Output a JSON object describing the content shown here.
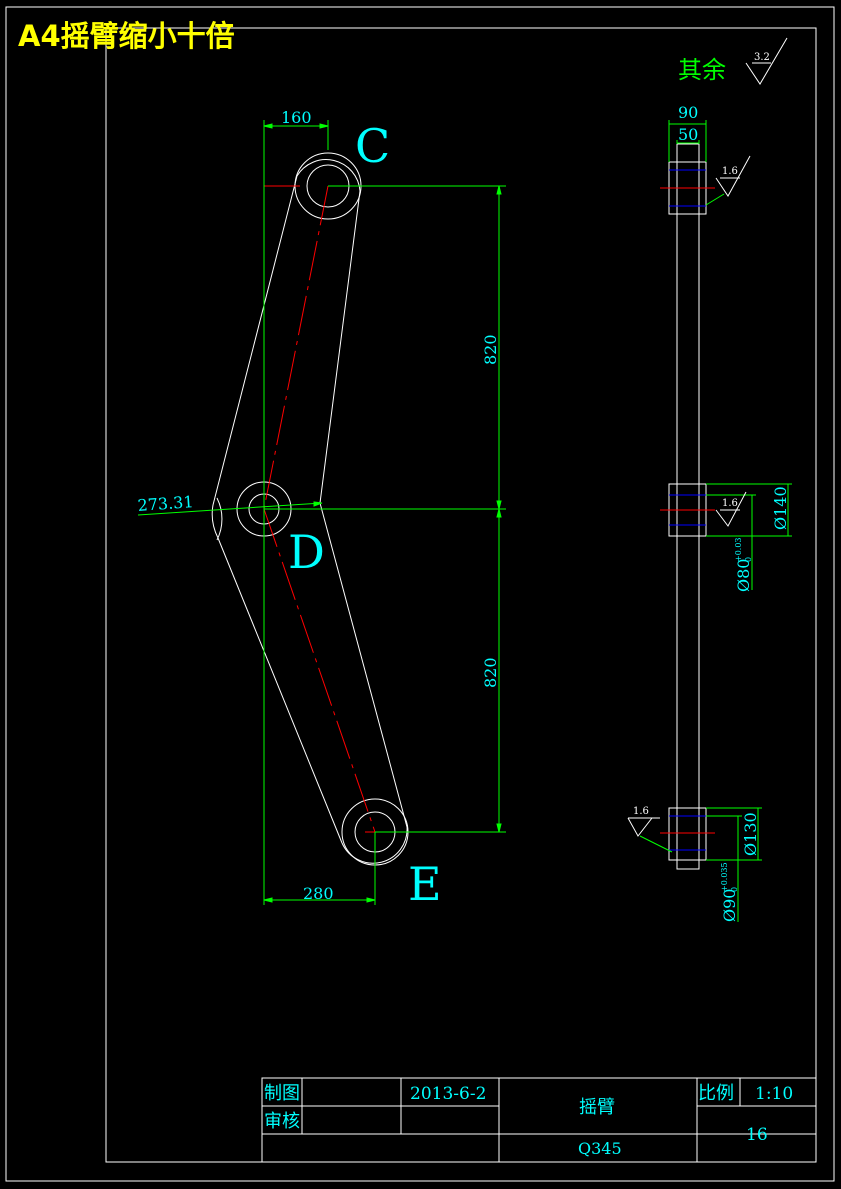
{
  "sheet_title": "A4摇臂缩小十倍",
  "surface_note": {
    "prefix": "其余",
    "roughness": "3.2"
  },
  "points": {
    "c": "C",
    "d": "D",
    "e": "E"
  },
  "dims": {
    "top_width": "160",
    "bottom_width": "280",
    "upper_length": "820",
    "lower_length": "820",
    "angle_offset": "273.31",
    "thickness_outer": "90",
    "thickness_inner": "50",
    "dia_140": "Ø140",
    "dia_130": "Ø130",
    "fit_80": "Ø80",
    "fit_80_tol_upper": "+0.03",
    "fit_80_tol_lower": "0",
    "fit_90": "Ø90",
    "fit_90_tol_upper": "+0.035",
    "fit_90_tol_lower": "0"
  },
  "roughness_marks": {
    "top": "1.6",
    "middle": "1.6",
    "bottom": "1.6"
  },
  "title_block": {
    "drawn_label": "制图",
    "check_label": "审核",
    "date": "2013-6-2",
    "part_name": "摇臂",
    "scale_label": "比例",
    "scale_value": "1:10",
    "material": "Q345",
    "sheet_no": "16"
  },
  "colors": {
    "outline": "#ffffff",
    "dimension": "#00ff00",
    "text_dim": "#00ffff",
    "center_line": "#ff0000",
    "hidden_line": "#0000ff",
    "title": "#ffff00",
    "note": "#00ff00"
  }
}
